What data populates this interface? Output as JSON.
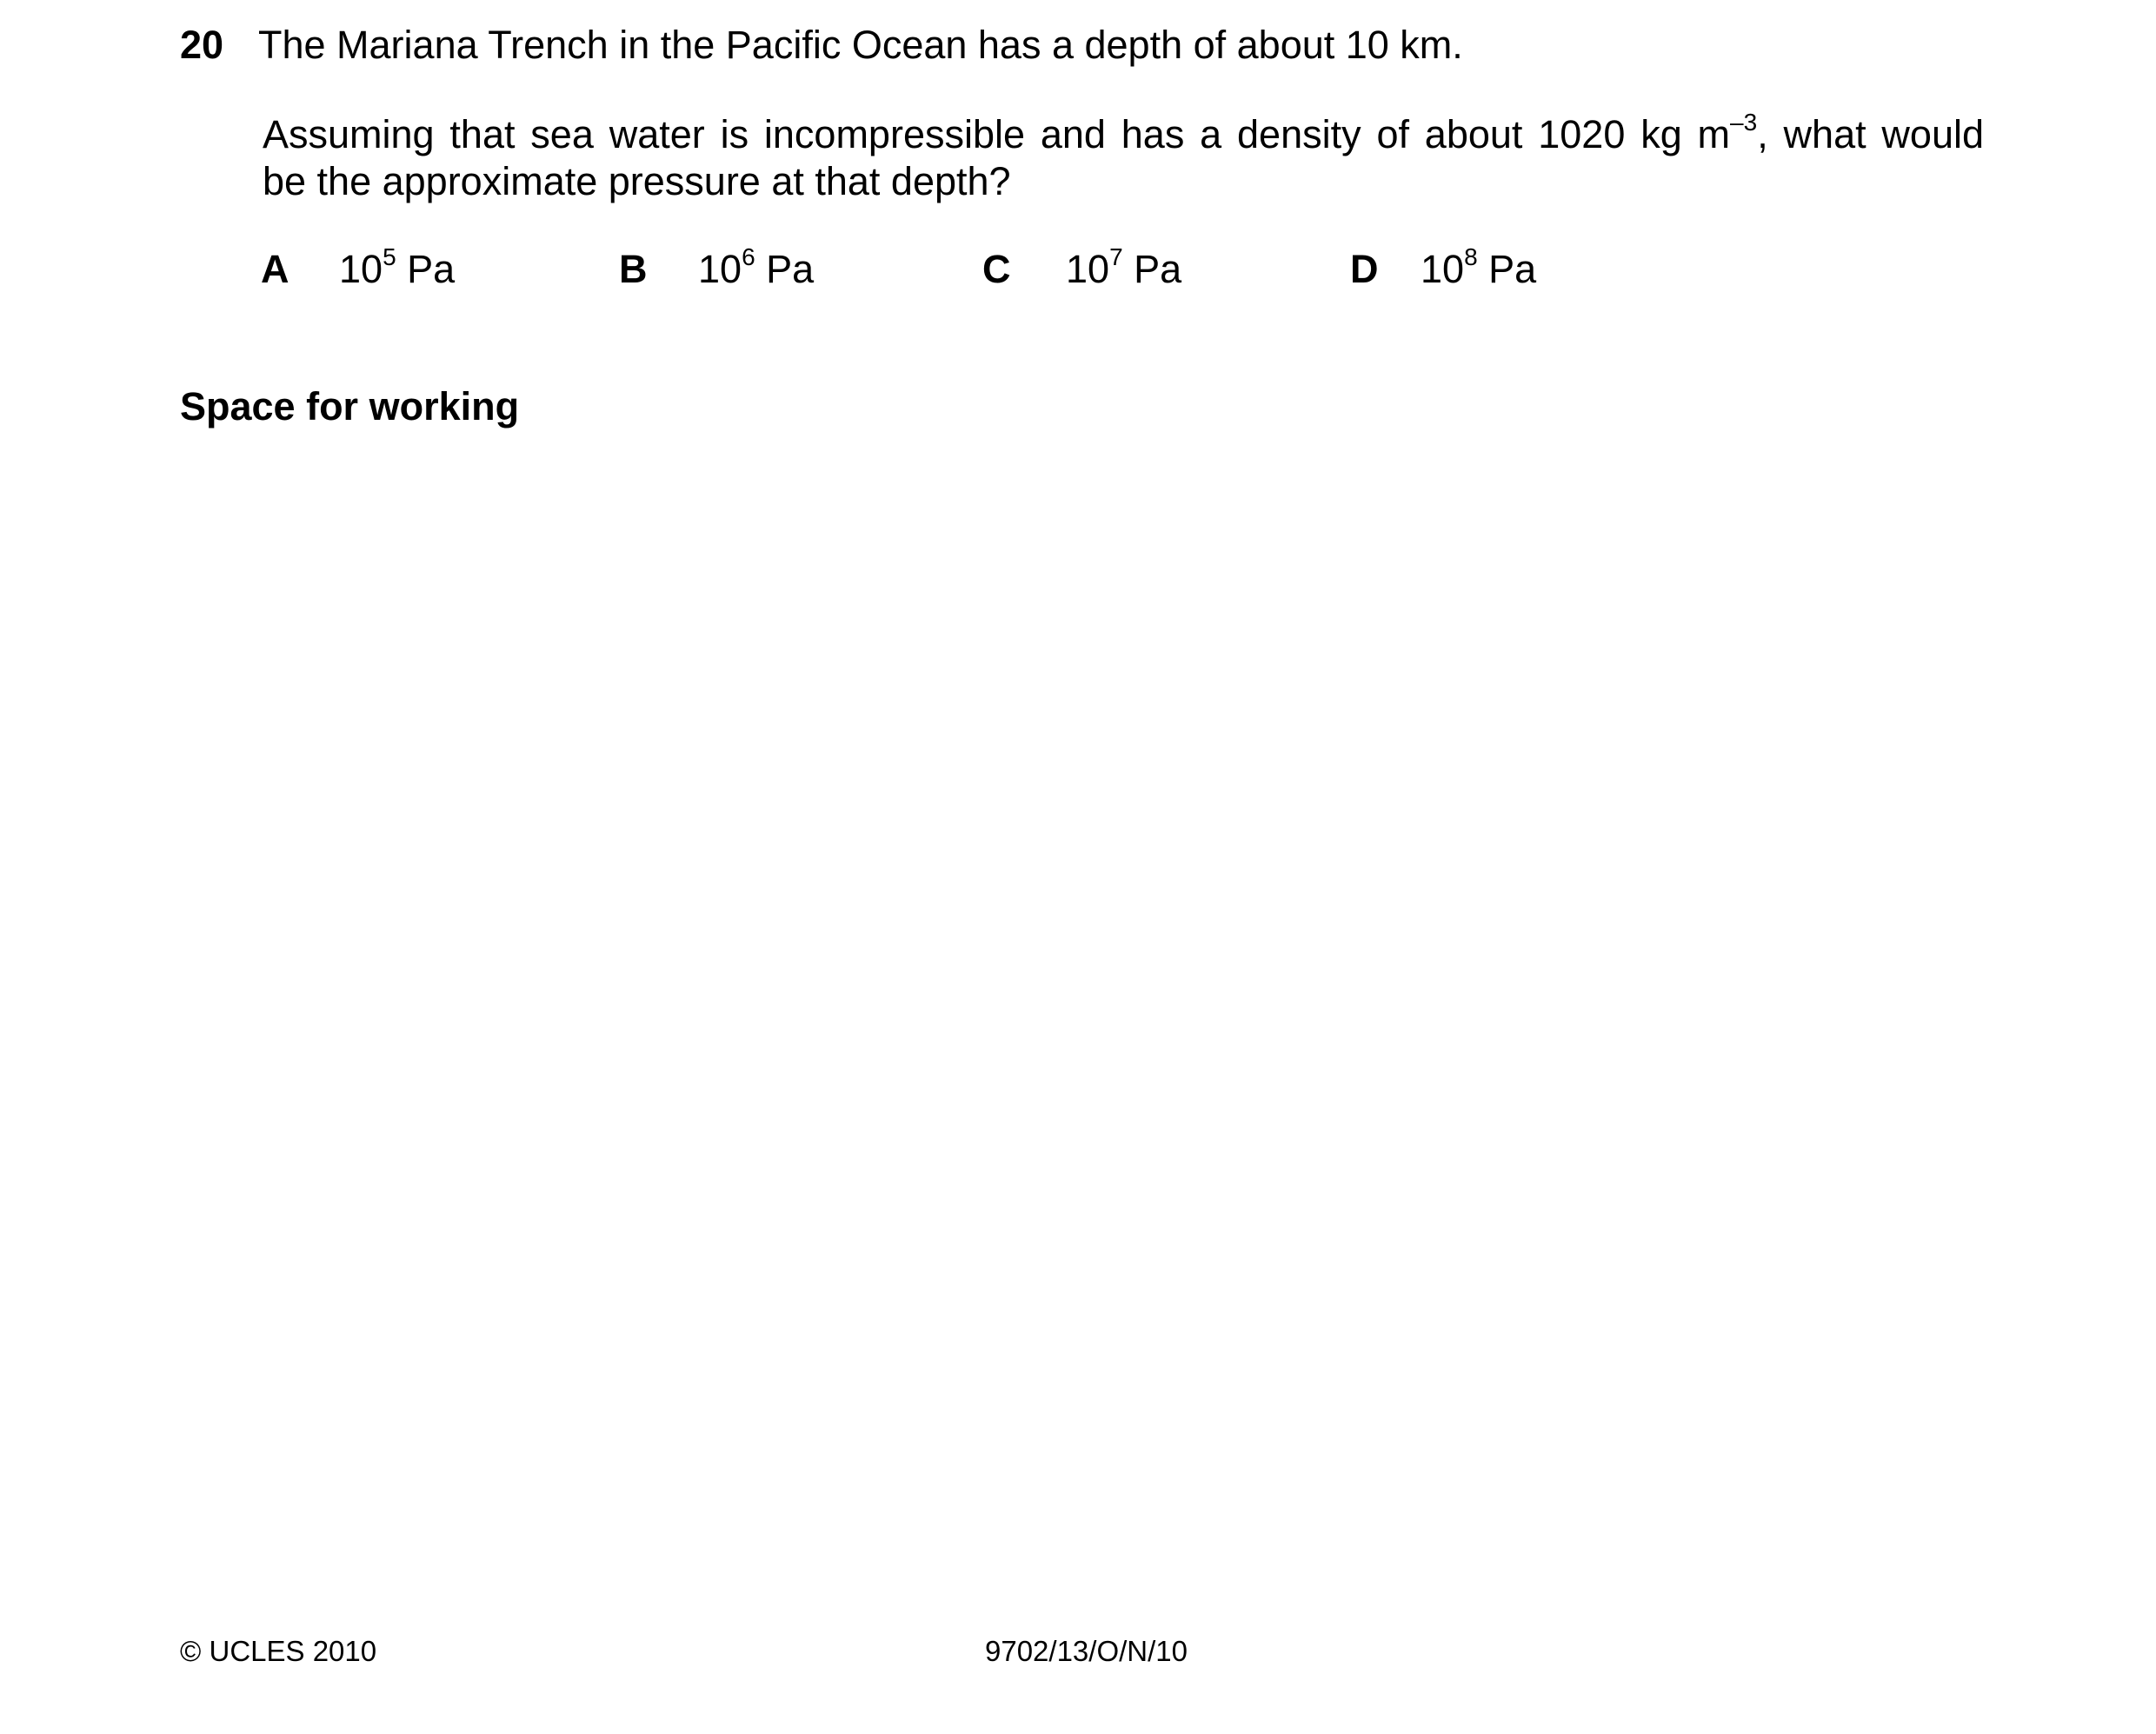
{
  "question": {
    "number": "20",
    "stem": "The Mariana Trench in the Pacific Ocean has a depth of about 10 km.",
    "line1_before_exp": "Assuming that sea water is incompressible and has a density of about 1020 kg m",
    "line1_exp": "–3",
    "line1_after_exp": ", what would",
    "line2": "be the approximate pressure at that depth?"
  },
  "options": [
    {
      "letter": "A",
      "base": "10",
      "exp": "5",
      "unit": " Pa"
    },
    {
      "letter": "B",
      "base": "10",
      "exp": "6",
      "unit": " Pa"
    },
    {
      "letter": "C",
      "base": "10",
      "exp": "7",
      "unit": " Pa"
    },
    {
      "letter": "D",
      "base": "10",
      "exp": "8",
      "unit": " Pa"
    }
  ],
  "working_label": "Space for working",
  "footer": {
    "copyright": "© UCLES 2010",
    "code": "9702/13/O/N/10"
  }
}
